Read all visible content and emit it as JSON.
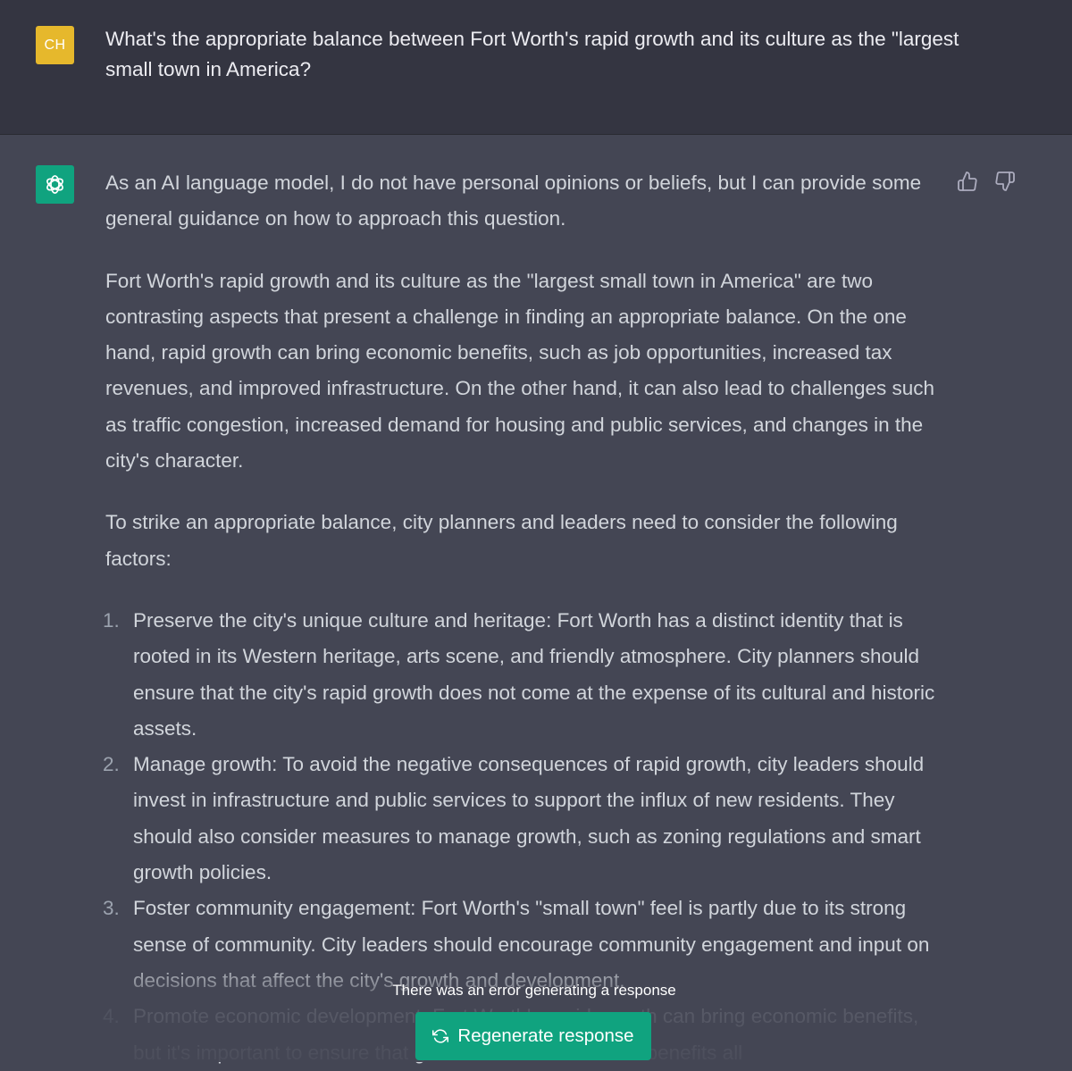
{
  "user": {
    "avatar_initials": "CH",
    "avatar_color": "#e6b82c",
    "message": "What's the appropriate balance between Fort Worth's rapid growth and its culture as the \"largest small town in America?"
  },
  "assistant": {
    "avatar_icon": "openai-logo-icon",
    "avatar_color": "#10a37f",
    "paragraphs": [
      "As an AI language model, I do not have personal opinions or beliefs, but I can provide some general guidance on how to approach this question.",
      "Fort Worth's rapid growth and its culture as the \"largest small town in America\" are two contrasting aspects that present a challenge in finding an appropriate balance. On the one hand, rapid growth can bring economic benefits, such as job opportunities, increased tax revenues, and improved infrastructure. On the other hand, it can also lead to challenges such as traffic congestion, increased demand for housing and public services, and changes in the city's character.",
      "To strike an appropriate balance, city planners and leaders need to consider the following factors:"
    ],
    "list": [
      {
        "num": "1.",
        "text": "Preserve the city's unique culture and heritage: Fort Worth has a distinct identity that is rooted in its Western heritage, arts scene, and friendly atmosphere. City planners should ensure that the city's rapid growth does not come at the expense of its cultural and historic assets."
      },
      {
        "num": "2.",
        "text": "Manage growth: To avoid the negative consequences of rapid growth, city leaders should invest in infrastructure and public services to support the influx of new residents. They should also consider measures to manage growth, such as zoning regulations and smart growth policies."
      },
      {
        "num": "3.",
        "text": "Foster community engagement: Fort Worth's \"small town\" feel is partly due to its strong sense of community. City leaders should encourage community engagement and input on decisions that affect the city's growth and development."
      },
      {
        "num": "4.",
        "text": "Promote economic development: Fort Worth's rapid growth can bring economic benefits, but it's important to ensure that growth is sustainable and benefits all"
      }
    ],
    "feedback": {
      "thumbs_up_icon": "thumbs-up-icon",
      "thumbs_down_icon": "thumbs-down-icon"
    }
  },
  "footer": {
    "error_message": "There was an error generating a response",
    "regenerate_label": "Regenerate response",
    "regenerate_icon": "refresh-icon",
    "accent": "#10a37f"
  }
}
